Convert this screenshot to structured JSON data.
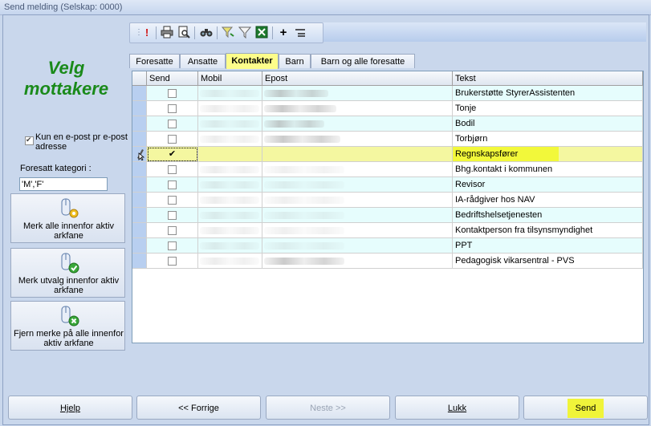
{
  "window": {
    "title": "Send melding (Selskap: 0000)"
  },
  "left": {
    "heading_line1": "Velg",
    "heading_line2": "mottakere",
    "email_only_checkbox": {
      "label": "Kun en e-post pr e-post adresse",
      "checked": true
    },
    "category_label": "Foresatt kategori :",
    "category_value": "'M','F'",
    "buttons": [
      {
        "label": "Merk alle innenfor aktiv arkfane",
        "icon": "select-all-icon"
      },
      {
        "label": "Merk utvalg innenfor aktiv arkfane",
        "icon": "select-checked-icon"
      },
      {
        "label": "Fjern merke på alle innenfor aktiv arkfane",
        "icon": "remove-marks-icon"
      }
    ]
  },
  "toolbar": {
    "icons": [
      "important-icon",
      "print-icon",
      "print-preview-icon",
      "find-icon",
      "filter-wizard-icon",
      "filter-icon",
      "excel-export-icon",
      "add-icon",
      "collapse-icon"
    ]
  },
  "tabs": [
    {
      "label": "Foresatte",
      "active": false
    },
    {
      "label": "Ansatte",
      "active": false
    },
    {
      "label": "Kontakter",
      "active": true
    },
    {
      "label": "Barn",
      "active": false
    },
    {
      "label": "Barn og alle foresatte",
      "active": false
    }
  ],
  "grid": {
    "columns": [
      "Send",
      "Mobil",
      "Epost",
      "Tekst"
    ],
    "rows": [
      {
        "send": false,
        "tekst": "Brukerstøtte StyrerAssistenten"
      },
      {
        "send": false,
        "tekst": "Tonje"
      },
      {
        "send": false,
        "tekst": "Bodil"
      },
      {
        "send": false,
        "tekst": "Torbjørn"
      },
      {
        "send": true,
        "tekst": "Regnskapsfører"
      },
      {
        "send": false,
        "tekst": "Bhg.kontakt i kommunen"
      },
      {
        "send": false,
        "tekst": "Revisor"
      },
      {
        "send": false,
        "tekst": "IA-rådgiver hos NAV"
      },
      {
        "send": false,
        "tekst": "Bedriftshelsetjenesten"
      },
      {
        "send": false,
        "tekst": "Kontaktperson fra tilsynsmyndighet"
      },
      {
        "send": false,
        "tekst": "PPT"
      },
      {
        "send": false,
        "tekst": "Pedagogisk vikarsentral - PVS"
      }
    ]
  },
  "footer": {
    "help": "Hjelp",
    "prev": "<< Forrige",
    "next": "Neste >>",
    "close": "Lukk",
    "send": "Send"
  },
  "colors": {
    "heading": "#1a8a1a",
    "highlight": "#f2f83a",
    "row_alt": "#e6fdfd"
  }
}
